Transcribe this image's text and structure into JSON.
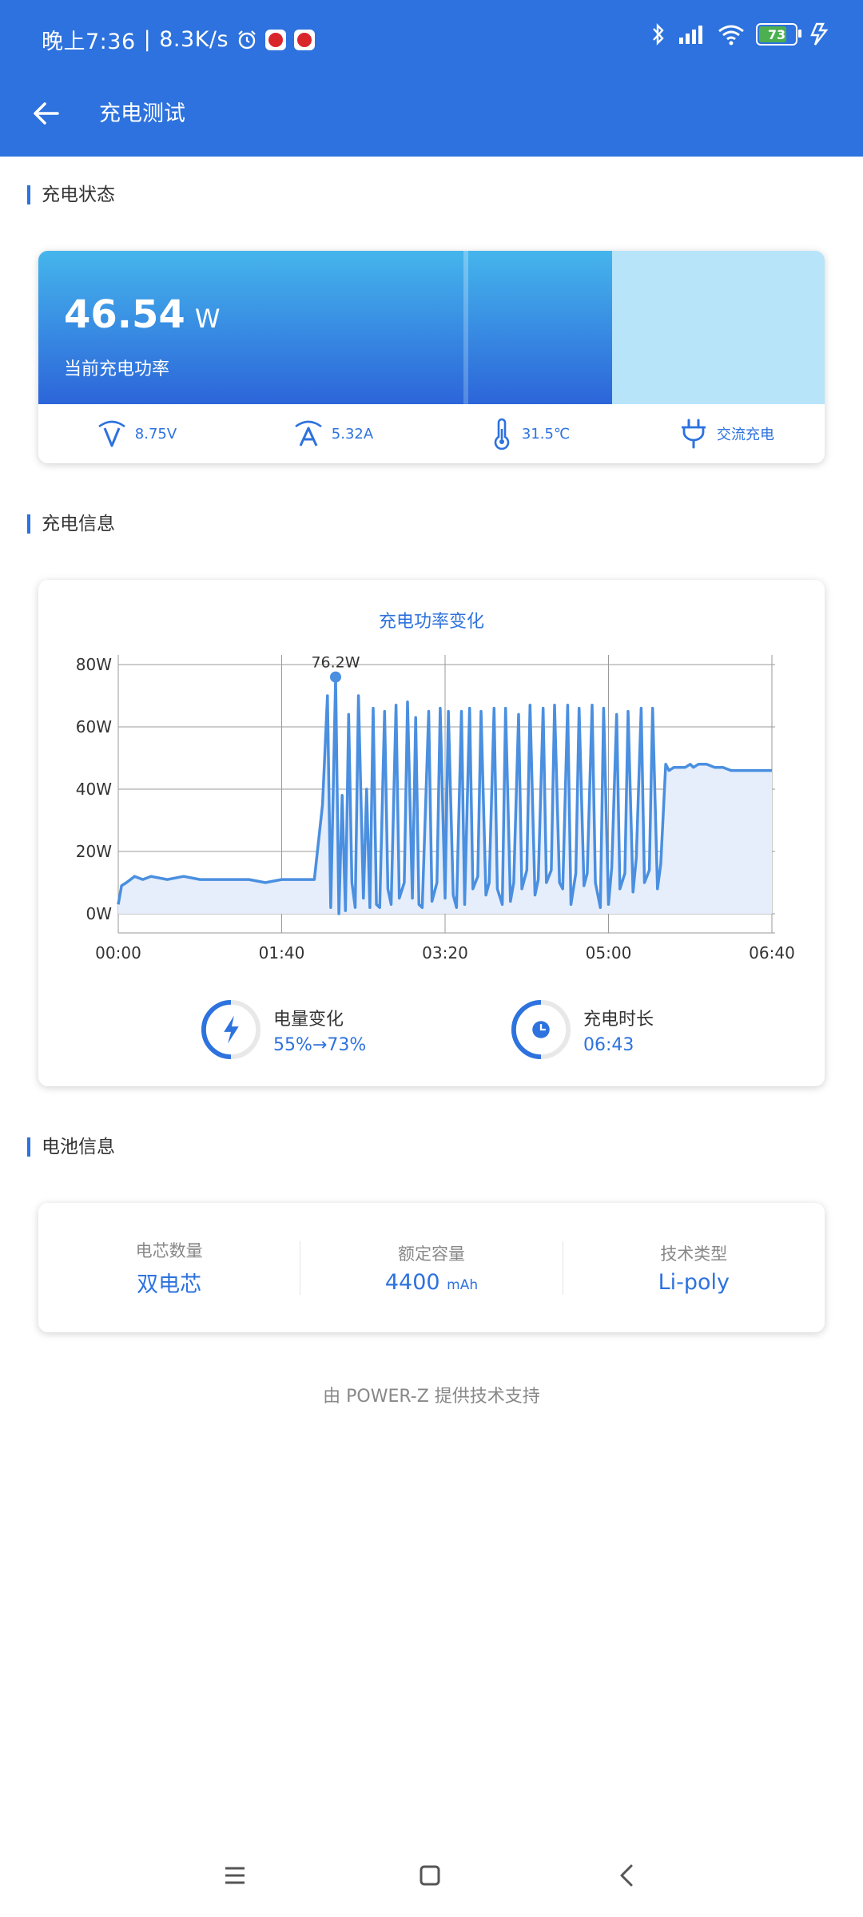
{
  "status": {
    "time": "晚上7:36",
    "speed": "8.3K/s",
    "battery": "73"
  },
  "toolbar": {
    "title": "充电测试"
  },
  "sections": {
    "charge_status": "充电状态",
    "charge_info": "充电信息",
    "battery_info": "电池信息"
  },
  "power": {
    "value": "46.54",
    "unit": "W",
    "label": "当前充电功率"
  },
  "metrics": {
    "voltage": "8.75V",
    "current": "5.32A",
    "temperature": "31.5℃",
    "mode": "交流充电"
  },
  "chart_data": {
    "type": "area",
    "title": "充电功率变化",
    "xlabel": "",
    "ylabel": "",
    "x_ticks": [
      "00:00",
      "01:40",
      "03:20",
      "05:00",
      "06:40"
    ],
    "y_ticks": [
      "0W",
      "20W",
      "40W",
      "60W",
      "80W"
    ],
    "xlim": [
      0,
      400
    ],
    "ylim": [
      0,
      80
    ],
    "grid": true,
    "peak_label": "76.2W",
    "series": [
      {
        "x": [
          0,
          2,
          5,
          10,
          15,
          20,
          30,
          40,
          50,
          60,
          70,
          80,
          90,
          100,
          110,
          120,
          125,
          128,
          130,
          133,
          135,
          137,
          139,
          141,
          143,
          145,
          147,
          150,
          152,
          154,
          156,
          158,
          160,
          163,
          165,
          167,
          170,
          172,
          175,
          177,
          180,
          182,
          184,
          186,
          190,
          192,
          195,
          197,
          200,
          202,
          205,
          207,
          210,
          212,
          215,
          217,
          220,
          222,
          225,
          227,
          230,
          232,
          235,
          237,
          240,
          242,
          245,
          247,
          250,
          252,
          255,
          257,
          260,
          262,
          265,
          267,
          270,
          272,
          275,
          277,
          280,
          282,
          285,
          287,
          290,
          292,
          295,
          297,
          300,
          302,
          305,
          307,
          310,
          312,
          315,
          317,
          320,
          322,
          325,
          327,
          330,
          332,
          335,
          337,
          340,
          342,
          345,
          347,
          350,
          352,
          355,
          357,
          360,
          365,
          370,
          375,
          380,
          385,
          390,
          395,
          400
        ],
        "y": [
          3,
          9,
          10,
          12,
          11,
          12,
          11,
          12,
          11,
          11,
          11,
          11,
          10,
          11,
          11,
          11,
          35,
          70,
          2,
          76,
          0,
          38,
          1,
          64,
          10,
          2,
          70,
          5,
          40,
          2,
          66,
          3,
          2,
          65,
          8,
          3,
          67,
          5,
          10,
          68,
          5,
          63,
          3,
          2,
          65,
          4,
          10,
          66,
          5,
          65,
          6,
          2,
          65,
          3,
          66,
          8,
          12,
          65,
          6,
          10,
          66,
          8,
          3,
          66,
          4,
          10,
          64,
          8,
          14,
          67,
          6,
          11,
          66,
          10,
          14,
          67,
          10,
          8,
          67,
          3,
          13,
          66,
          9,
          13,
          67,
          10,
          2,
          66,
          3,
          15,
          64,
          8,
          13,
          65,
          7,
          18,
          66,
          10,
          14,
          66,
          8,
          16,
          48,
          46,
          47,
          47,
          47,
          47,
          48,
          47,
          48,
          48,
          48,
          47,
          47,
          46,
          46,
          46,
          46,
          46,
          46
        ]
      }
    ]
  },
  "stats": {
    "capacity_change": {
      "label": "电量变化",
      "value": "55%→73%"
    },
    "duration": {
      "label": "充电时长",
      "value": "06:43"
    }
  },
  "battery": {
    "cells": {
      "label": "电芯数量",
      "value": "双电芯"
    },
    "capacity": {
      "label": "额定容量",
      "value": "4400",
      "unit": "mAh"
    },
    "tech": {
      "label": "技术类型",
      "value": "Li-poly"
    }
  },
  "footer": "由 POWER-Z 提供技术支持",
  "colors": {
    "primary": "#2d72de",
    "chart_line": "#4a8fe0",
    "chart_fill": "#e6eefb"
  }
}
